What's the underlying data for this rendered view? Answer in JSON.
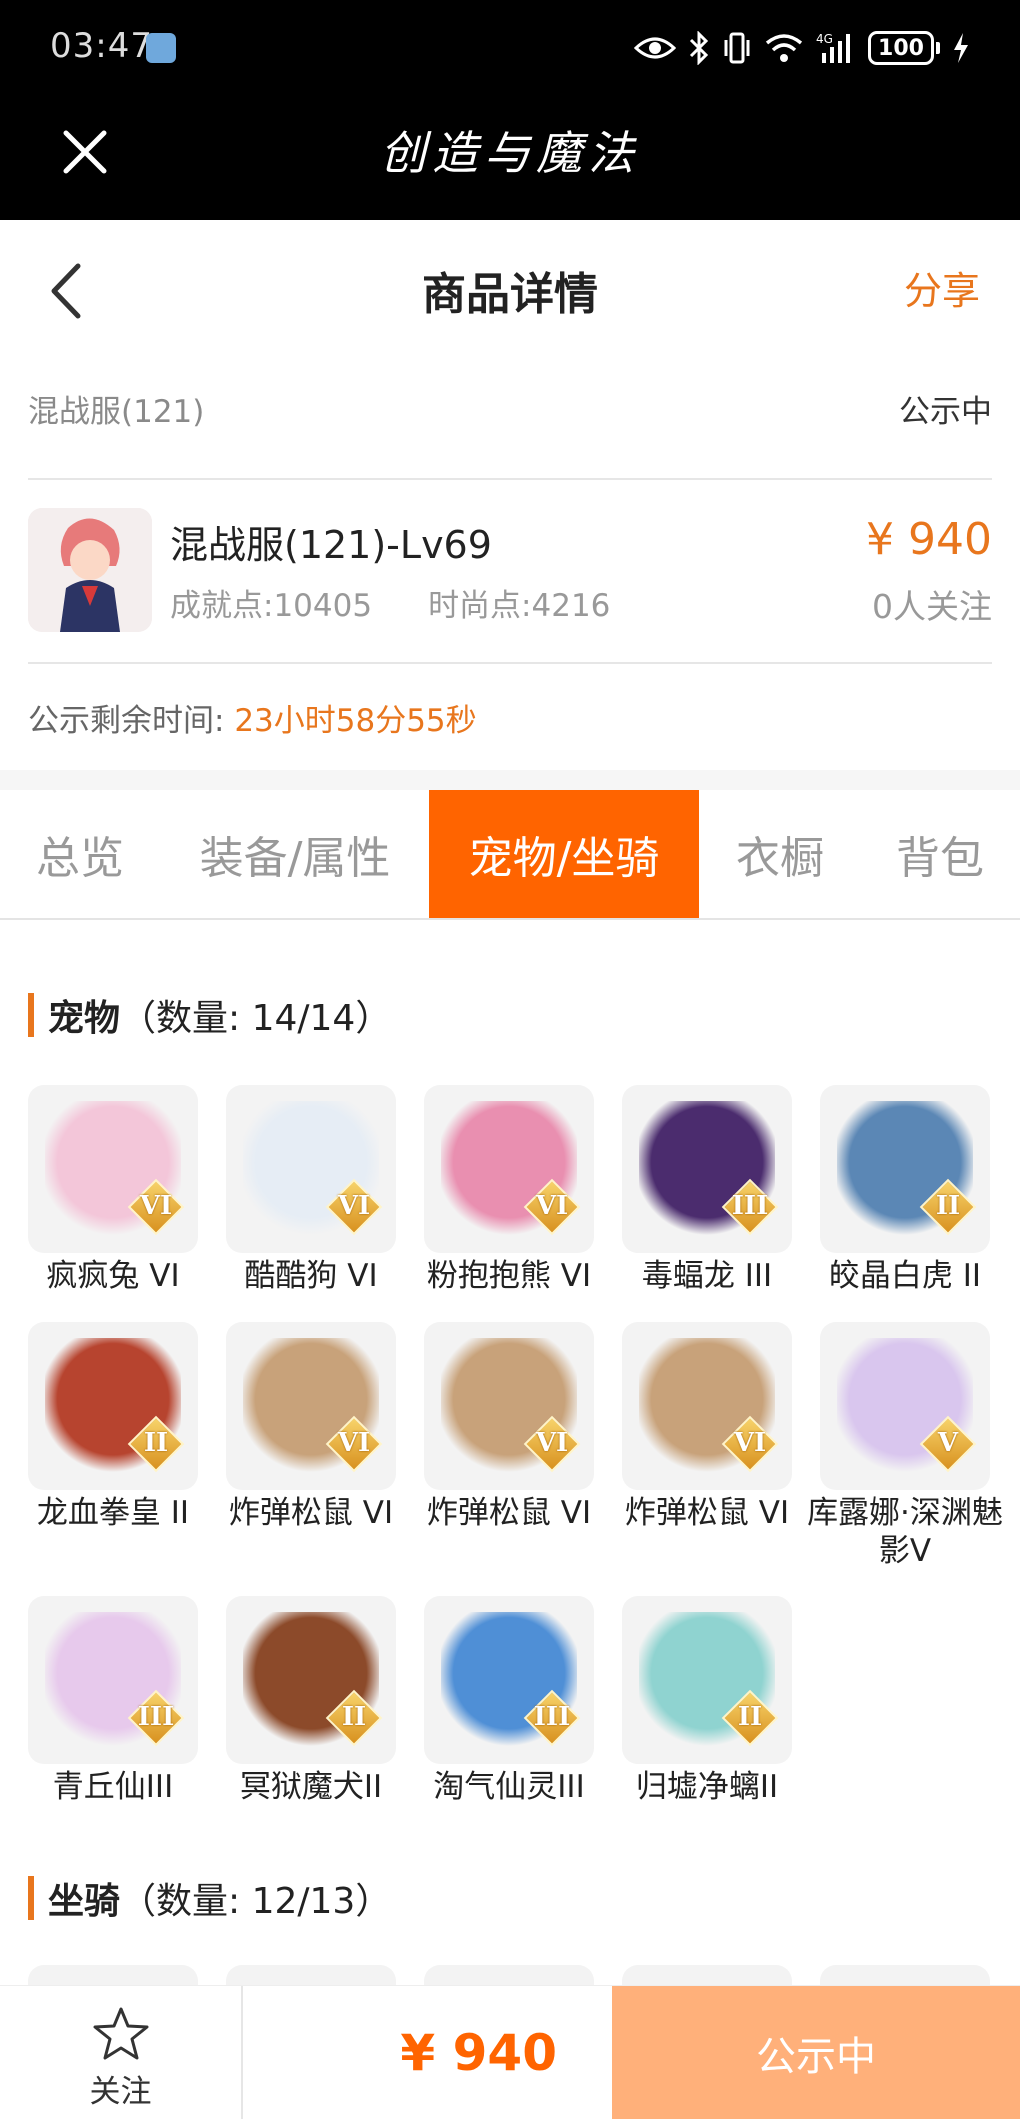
{
  "status_bar": {
    "time": "03:47",
    "battery": "100"
  },
  "app_bar": {
    "title": "创造与魔法"
  },
  "header": {
    "title": "商品详情",
    "share": "分享"
  },
  "summary": {
    "server": "混战服(121)",
    "status": "公示中",
    "char_name": "混战服(121)-Lv69",
    "achievement": "成就点:10405",
    "fashion": "时尚点:4216",
    "price": "¥ 940",
    "followers": "0人关注",
    "remain_label": "公示剩余时间:",
    "remain_value": "23小时58分55秒"
  },
  "tabs": [
    {
      "label": "总览",
      "active": false
    },
    {
      "label": "装备/属性",
      "active": false
    },
    {
      "label": "宠物/坐骑",
      "active": true
    },
    {
      "label": "衣橱",
      "active": false
    },
    {
      "label": "背包",
      "active": false
    }
  ],
  "pets": {
    "title": "宠物",
    "count": "（数量:  14/14）",
    "items": [
      {
        "name": "疯疯兔 VI",
        "rank": "VI",
        "color": "#f3c6d9"
      },
      {
        "name": "酷酷狗 VI",
        "rank": "VI",
        "color": "#e6edf5"
      },
      {
        "name": "粉抱抱熊 VI",
        "rank": "VI",
        "color": "#e98fb0"
      },
      {
        "name": "毒蝠龙 III",
        "rank": "III",
        "color": "#4b2c6e"
      },
      {
        "name": "皎晶白虎 II",
        "rank": "II",
        "color": "#5b87b5"
      },
      {
        "name": "龙血拳皇 II",
        "rank": "II",
        "color": "#b7442f"
      },
      {
        "name": "炸弹松鼠 VI",
        "rank": "VI",
        "color": "#c8a27a"
      },
      {
        "name": "炸弹松鼠 VI",
        "rank": "VI",
        "color": "#c8a27a"
      },
      {
        "name": "炸弹松鼠 VI",
        "rank": "VI",
        "color": "#c8a27a"
      },
      {
        "name": "库露娜·深渊魅影V",
        "rank": "V",
        "color": "#d9c6ee"
      },
      {
        "name": "青丘仙III",
        "rank": "III",
        "color": "#e7c9ec"
      },
      {
        "name": "冥狱魔犬II",
        "rank": "II",
        "color": "#8c4a2a"
      },
      {
        "name": "淘气仙灵III",
        "rank": "III",
        "color": "#4f8fd6"
      },
      {
        "name": "归墟净螭II",
        "rank": "II",
        "color": "#8fd3d0"
      }
    ]
  },
  "mounts": {
    "title": "坐骑",
    "count": "（数量:  12/13）"
  },
  "bottom_bar": {
    "follow": "关注",
    "price": "¥ 940",
    "status": "公示中"
  }
}
